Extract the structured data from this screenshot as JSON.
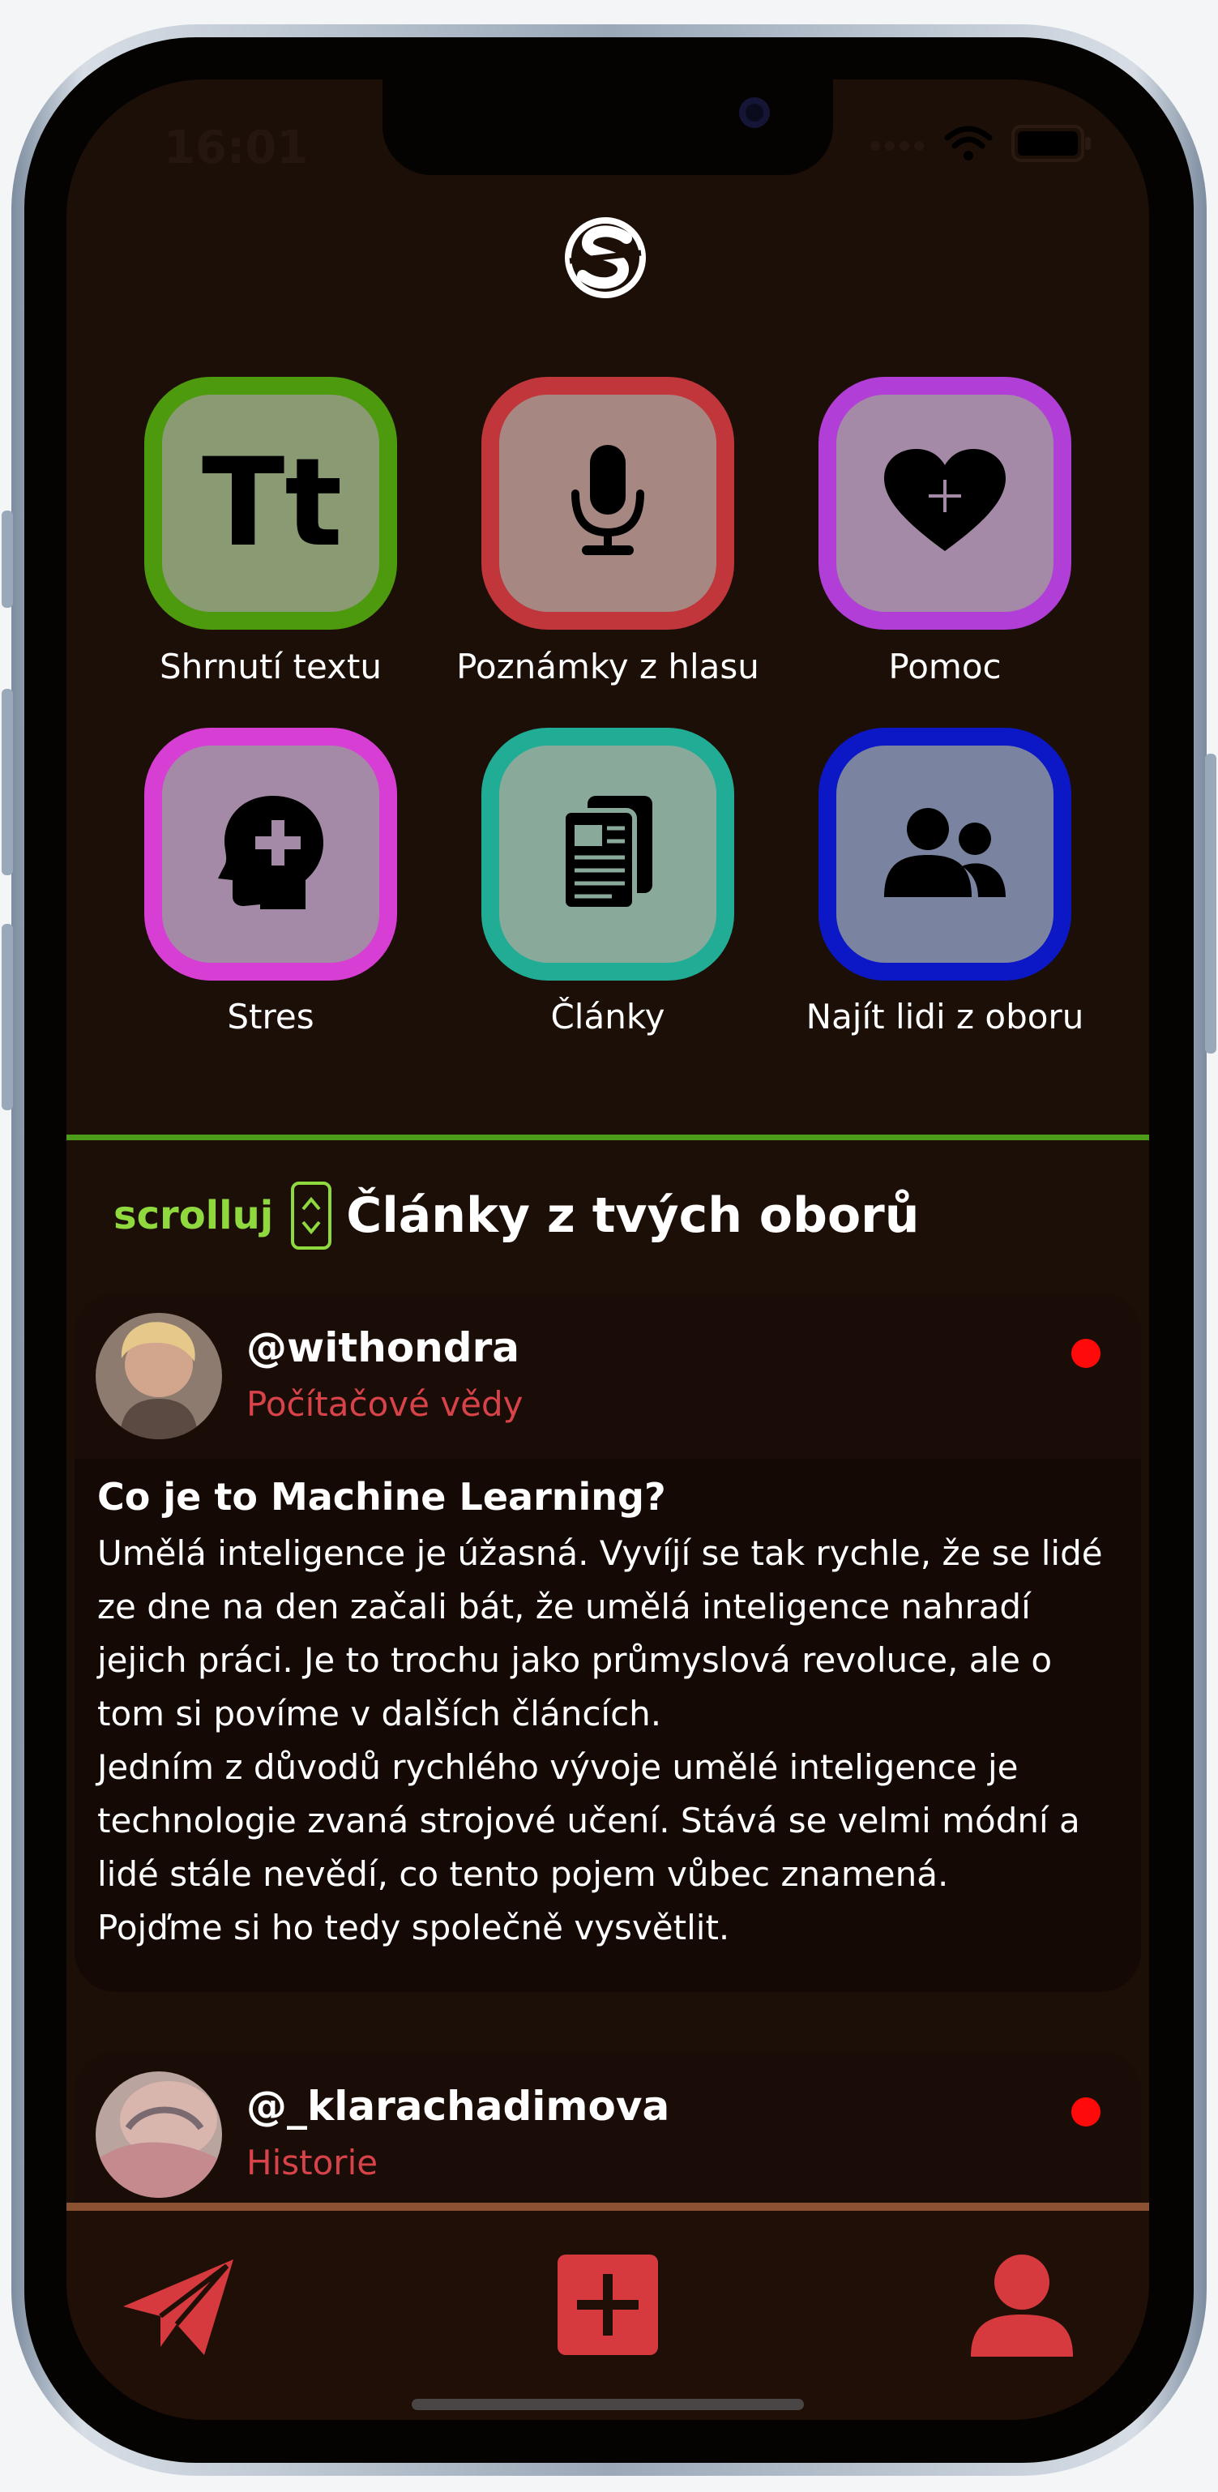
{
  "status_bar": {
    "time": "16:01",
    "icons": [
      "signal-icon",
      "wifi-icon",
      "battery-icon"
    ]
  },
  "header": {
    "logo_icon": "app-logo-icon"
  },
  "tiles": [
    {
      "label": "Shrnutí textu",
      "icon": "text-summary-icon",
      "color": "#4e9a0f",
      "fill": "#8a9a73"
    },
    {
      "label": "Poznámky z hlasu",
      "icon": "microphone-icon",
      "color": "#c0363b",
      "fill": "#a78781"
    },
    {
      "label": "Pomoc",
      "icon": "heart-icon",
      "color": "#b23ed8",
      "fill": "#a48aa6"
    },
    {
      "label": "Stres",
      "icon": "mental-health-icon",
      "color": "#d73fd4",
      "fill": "#a48aa6"
    },
    {
      "label": "Články",
      "icon": "newspaper-icon",
      "color": "#21ad95",
      "fill": "#89a99a"
    },
    {
      "label": "Najít lidi z oboru",
      "icon": "people-icon",
      "color": "#0c18c5",
      "fill": "#7a84a1"
    }
  ],
  "section": {
    "scroll_label": "scrolluj",
    "title": "Články z tvých oborů"
  },
  "posts": [
    {
      "username": "@withondra",
      "field": "Počítačové vědy",
      "title": "Co je to Machine Learning?",
      "body": "Umělá inteligence je úžasná. Vyvíjí se tak rychle, že se lidé\nze dne na den začali bát, že umělá inteligence nahradí\njejich práci. Je to trochu jako průmyslová revoluce, ale o\ntom si povíme v dalších článcích.\nJedním z důvodů rychlého vývoje umělé inteligence je\ntechnologie zvaná strojové učení. Stává se velmi módní a\nlidé stále nevědí, co tento pojem vůbec znamená.\nPojďme si ho tedy společně vysvětlit."
    },
    {
      "username": "@_klarachadimova",
      "field": "Historie"
    }
  ],
  "tab_bar": [
    "send-icon",
    "add-icon",
    "profile-icon"
  ],
  "colors": {
    "accent_green": "#8fd93f",
    "accent_red": "#d8434a",
    "background": "#1c0f08"
  }
}
